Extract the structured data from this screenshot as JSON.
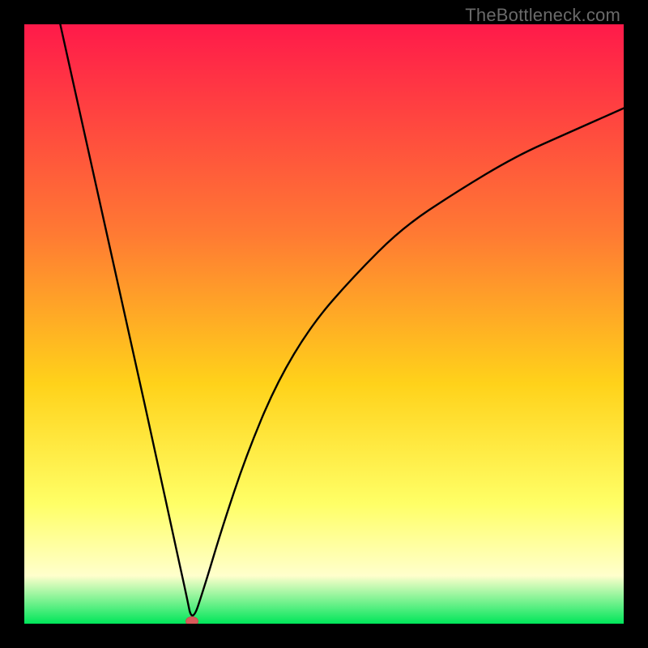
{
  "watermark": {
    "text": "TheBottleneck.com"
  },
  "colors": {
    "top": "#ff1a4a",
    "mid_upper": "#ff7a33",
    "mid": "#ffd21a",
    "mid_lower": "#ffff66",
    "pale": "#ffffcc",
    "bottom": "#00e65a",
    "curve": "#000000",
    "marker": "#d85a5a"
  },
  "chart_data": {
    "type": "line",
    "title": "",
    "xlabel": "",
    "ylabel": "",
    "x_range": [
      0,
      100
    ],
    "y_range": [
      0,
      100
    ],
    "description": "V-shaped bottleneck curve with minimum near x≈28. Left branch descends steeply from y≈100 at x≈6 to y≈0 at x≈28. Right branch rises with diminishing slope to y≈86 at x=100.",
    "series": [
      {
        "name": "bottleneck-curve",
        "x": [
          6,
          10,
          14,
          18,
          22,
          25,
          27,
          28,
          30,
          33,
          37,
          42,
          48,
          55,
          63,
          72,
          82,
          91,
          100
        ],
        "y": [
          100,
          82,
          64,
          46,
          28,
          14,
          5,
          0,
          6,
          16,
          28,
          40,
          50,
          58,
          66,
          72,
          78,
          82,
          86
        ]
      }
    ],
    "marker": {
      "x": 28,
      "y": 0
    },
    "background_gradient_stops": [
      {
        "pct": 0,
        "role": "top"
      },
      {
        "pct": 35,
        "role": "mid_upper"
      },
      {
        "pct": 60,
        "role": "mid"
      },
      {
        "pct": 80,
        "role": "mid_lower"
      },
      {
        "pct": 92,
        "role": "pale"
      },
      {
        "pct": 100,
        "role": "bottom"
      }
    ]
  }
}
